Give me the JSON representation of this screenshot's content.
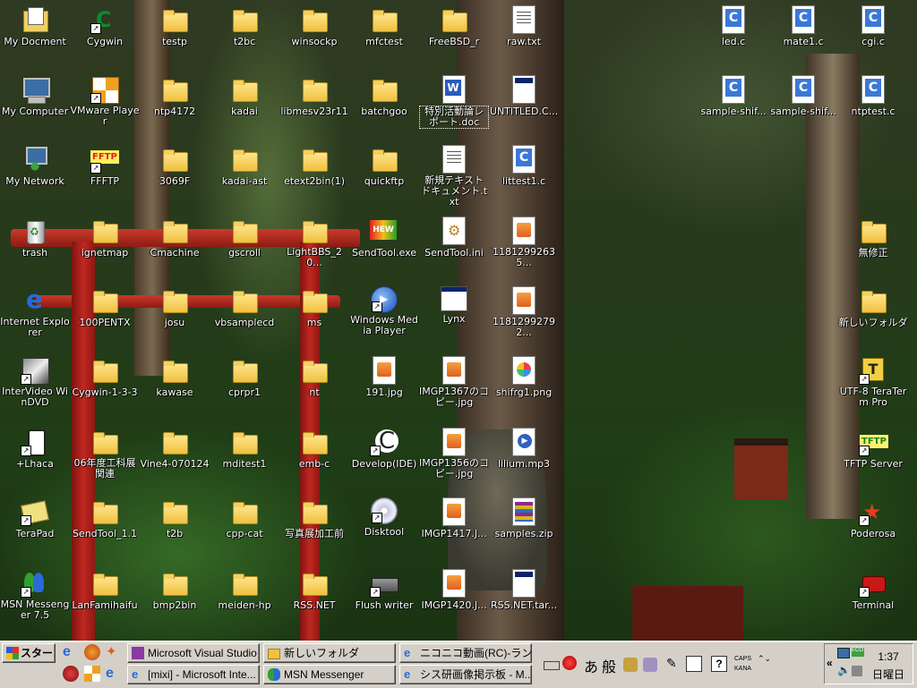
{
  "desktop_icons": [
    {
      "label": "My Docment",
      "type": "mydocs",
      "shortcut": false
    },
    {
      "label": "Cygwin",
      "type": "cygwin",
      "shortcut": true
    },
    {
      "label": "testp",
      "type": "folder",
      "shortcut": false
    },
    {
      "label": "t2bc",
      "type": "folder",
      "shortcut": false
    },
    {
      "label": "winsockp",
      "type": "folder",
      "shortcut": false
    },
    {
      "label": "mfctest",
      "type": "folder",
      "shortcut": false
    },
    {
      "label": "FreeBSD_r",
      "type": "folder",
      "shortcut": false
    },
    {
      "label": "raw.txt",
      "type": "txt",
      "shortcut": false
    },
    {
      "label": "led.c",
      "type": "cfile",
      "shortcut": false
    },
    {
      "label": "mate1.c",
      "type": "cfile",
      "shortcut": false
    },
    {
      "label": "cgi.c",
      "type": "cfile",
      "shortcut": false
    },
    {
      "label": "My Computer",
      "type": "computer",
      "shortcut": false
    },
    {
      "label": "VMware Player",
      "type": "vmware",
      "shortcut": true
    },
    {
      "label": "ntp4172",
      "type": "folder",
      "shortcut": false
    },
    {
      "label": "kadai",
      "type": "folder",
      "shortcut": false
    },
    {
      "label": "libmesv23r11",
      "type": "folder",
      "shortcut": false
    },
    {
      "label": "batchgoo",
      "type": "folder",
      "shortcut": false
    },
    {
      "label": "特別活動論レポート.doc",
      "type": "doc",
      "shortcut": false,
      "selected": true
    },
    {
      "label": "UNTITLED.C...",
      "type": "exe",
      "shortcut": false
    },
    {
      "label": "sample-shif...",
      "type": "cfile",
      "shortcut": false
    },
    {
      "label": "sample-shif...",
      "type": "cfile",
      "shortcut": false
    },
    {
      "label": "ntptest.c",
      "type": "cfile",
      "shortcut": false
    },
    {
      "label": "My Network",
      "type": "network",
      "shortcut": false
    },
    {
      "label": "FFFTP",
      "type": "ffftp",
      "shortcut": true
    },
    {
      "label": "3069F",
      "type": "folder",
      "shortcut": false
    },
    {
      "label": "kadai-ast",
      "type": "folder",
      "shortcut": false
    },
    {
      "label": "etext2bin(1)",
      "type": "folder",
      "shortcut": false
    },
    {
      "label": "quickftp",
      "type": "folder",
      "shortcut": false
    },
    {
      "label": "新規テキスト ドキュメント.txt",
      "type": "txt",
      "shortcut": false
    },
    {
      "label": "littest1.c",
      "type": "cfile",
      "shortcut": false
    },
    {
      "label": "trash",
      "type": "trash",
      "shortcut": false
    },
    {
      "label": "ignetmap",
      "type": "folder",
      "shortcut": false
    },
    {
      "label": "Cmachine",
      "type": "folder",
      "shortcut": false
    },
    {
      "label": "gscroll",
      "type": "folder",
      "shortcut": false
    },
    {
      "label": "LightBBS_20...",
      "type": "folder",
      "shortcut": false
    },
    {
      "label": "SendTool.exe",
      "type": "sendtoolexe",
      "shortcut": false
    },
    {
      "label": "SendTool.ini",
      "type": "ini",
      "shortcut": false
    },
    {
      "label": "11812992635...",
      "type": "img",
      "shortcut": false
    },
    {
      "label": "無修正",
      "type": "folder",
      "shortcut": false
    },
    {
      "label": "Internet Explorer",
      "type": "ie",
      "shortcut": false
    },
    {
      "label": "100PENTX",
      "type": "folder",
      "shortcut": false
    },
    {
      "label": "josu",
      "type": "folder",
      "shortcut": false
    },
    {
      "label": "vbsamplecd",
      "type": "folder",
      "shortcut": false
    },
    {
      "label": "ms",
      "type": "folder",
      "shortcut": false
    },
    {
      "label": "Windows Media Player",
      "type": "wmp",
      "shortcut": true
    },
    {
      "label": "Lynx",
      "type": "lynx",
      "shortcut": false
    },
    {
      "label": "11812992792...",
      "type": "img",
      "shortcut": false
    },
    {
      "label": "新しいフォルダ",
      "type": "folder",
      "shortcut": false
    },
    {
      "label": "InterVideo WinDVD",
      "type": "intervideo",
      "shortcut": true
    },
    {
      "label": "Cygwin-1-3-3",
      "type": "folder",
      "shortcut": false
    },
    {
      "label": "kawase",
      "type": "folder",
      "shortcut": false
    },
    {
      "label": "cprpr1",
      "type": "folder",
      "shortcut": false
    },
    {
      "label": "nt",
      "type": "folder",
      "shortcut": false
    },
    {
      "label": "191.jpg",
      "type": "img",
      "shortcut": false
    },
    {
      "label": "IMGP1367のコピー.jpg",
      "type": "img",
      "shortcut": false
    },
    {
      "label": "shifrg1.png",
      "type": "png",
      "shortcut": false
    },
    {
      "label": "UTF-8 TeraTerm Pro",
      "type": "teraterm",
      "shortcut": true
    },
    {
      "label": "+Lhaca",
      "type": "lhaca",
      "shortcut": true
    },
    {
      "label": "06年度工科展関連",
      "type": "folder",
      "shortcut": false
    },
    {
      "label": "Vine4-070124",
      "type": "folder",
      "shortcut": false
    },
    {
      "label": "mditest1",
      "type": "folder",
      "shortcut": false
    },
    {
      "label": "emb-c",
      "type": "folder",
      "shortcut": false
    },
    {
      "label": "Develop(IDE)",
      "type": "develop",
      "shortcut": true
    },
    {
      "label": "IMGP1356のコピー.jpg",
      "type": "img",
      "shortcut": false
    },
    {
      "label": "lilium.mp3",
      "type": "audio",
      "shortcut": false
    },
    {
      "label": "TFTP Server",
      "type": "tftp",
      "shortcut": true
    },
    {
      "label": "TeraPad",
      "type": "terapad",
      "shortcut": true
    },
    {
      "label": "SendTool_1.1",
      "type": "folder",
      "shortcut": false
    },
    {
      "label": "t2b",
      "type": "folder",
      "shortcut": false
    },
    {
      "label": "cpp-cat",
      "type": "folder",
      "shortcut": false
    },
    {
      "label": "写真展加工前",
      "type": "folder",
      "shortcut": false
    },
    {
      "label": "Disktool",
      "type": "cd",
      "shortcut": true
    },
    {
      "label": "IMGP1417.J...",
      "type": "img",
      "shortcut": false
    },
    {
      "label": "samples.zip",
      "type": "zip",
      "shortcut": false
    },
    {
      "label": "Poderosa",
      "type": "poderosa",
      "shortcut": true
    },
    {
      "label": "MSN Messenger 7.5",
      "type": "msn",
      "shortcut": true
    },
    {
      "label": "LanFamihaifu",
      "type": "folder",
      "shortcut": false
    },
    {
      "label": "bmp2bin",
      "type": "folder",
      "shortcut": false
    },
    {
      "label": "meiden-hp",
      "type": "folder",
      "shortcut": false
    },
    {
      "label": "RSS.NET",
      "type": "folder",
      "shortcut": false
    },
    {
      "label": "Flush writer",
      "type": "flash",
      "shortcut": true
    },
    {
      "label": "IMGP1420.J...",
      "type": "img",
      "shortcut": false
    },
    {
      "label": "RSS.NET.tar...",
      "type": "exe",
      "shortcut": false
    },
    {
      "label": "Terminal",
      "type": "terminal",
      "shortcut": true
    }
  ],
  "taskbar": {
    "start_label": "スタート",
    "tasks": [
      {
        "label": "Microsoft Visual Studio"
      },
      {
        "label": "新しいフォルダ"
      },
      {
        "label": "ニコニコ動画(RC)‐ランキ..."
      },
      {
        "label": "[mixi] - Microsoft Inte..."
      },
      {
        "label": "MSN Messenger"
      },
      {
        "label": "シス研画像掲示板 - M..."
      }
    ],
    "ime": {
      "mode_a": "あ",
      "mode_b": "般",
      "caps": "CAPS",
      "kana": "KANA"
    },
    "clock": "1:37",
    "day": "日曜日"
  },
  "colors": {
    "taskbar": "#d4d0c8",
    "start_text": "#000000",
    "label_text": "#ffffff"
  }
}
